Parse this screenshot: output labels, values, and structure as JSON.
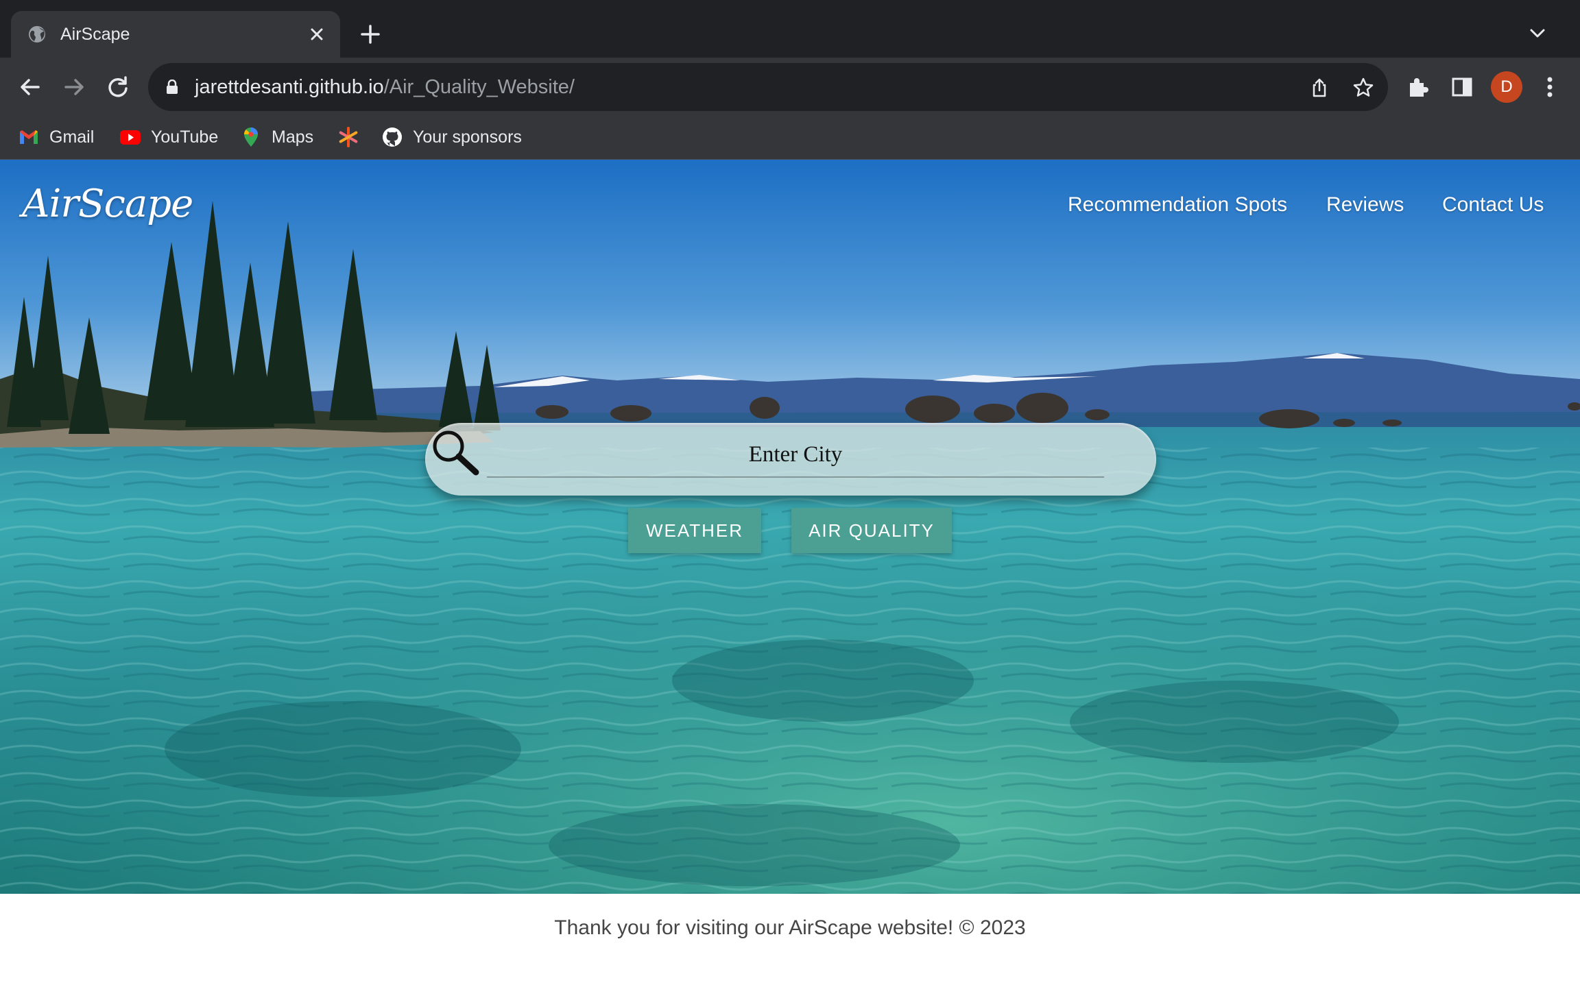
{
  "browser": {
    "tab_title": "AirScape",
    "url_host": "jarettdesanti.github.io",
    "url_path": "/Air_Quality_Website/",
    "profile_initial": "D",
    "bookmarks": [
      {
        "label": "Gmail",
        "icon": "gmail-icon"
      },
      {
        "label": "YouTube",
        "icon": "youtube-icon"
      },
      {
        "label": "Maps",
        "icon": "maps-icon"
      },
      {
        "label": "",
        "icon": "asterisk-app-icon"
      },
      {
        "label": "Your sponsors",
        "icon": "github-icon"
      }
    ]
  },
  "page": {
    "brand": "AirScape",
    "nav": {
      "recommendation": "Recommendation Spots",
      "reviews": "Reviews",
      "contact": "Contact Us"
    },
    "search": {
      "placeholder": "Enter City",
      "value": ""
    },
    "buttons": {
      "weather": "WEATHER",
      "air_quality": "AIR QUALITY"
    },
    "footer": "Thank you for visiting our AirScape website! © 2023"
  },
  "colors": {
    "button_bg": "#4c9f93",
    "avatar_bg": "#c5461f",
    "chrome_dark": "#202124",
    "chrome_toolbar": "#35363a"
  }
}
